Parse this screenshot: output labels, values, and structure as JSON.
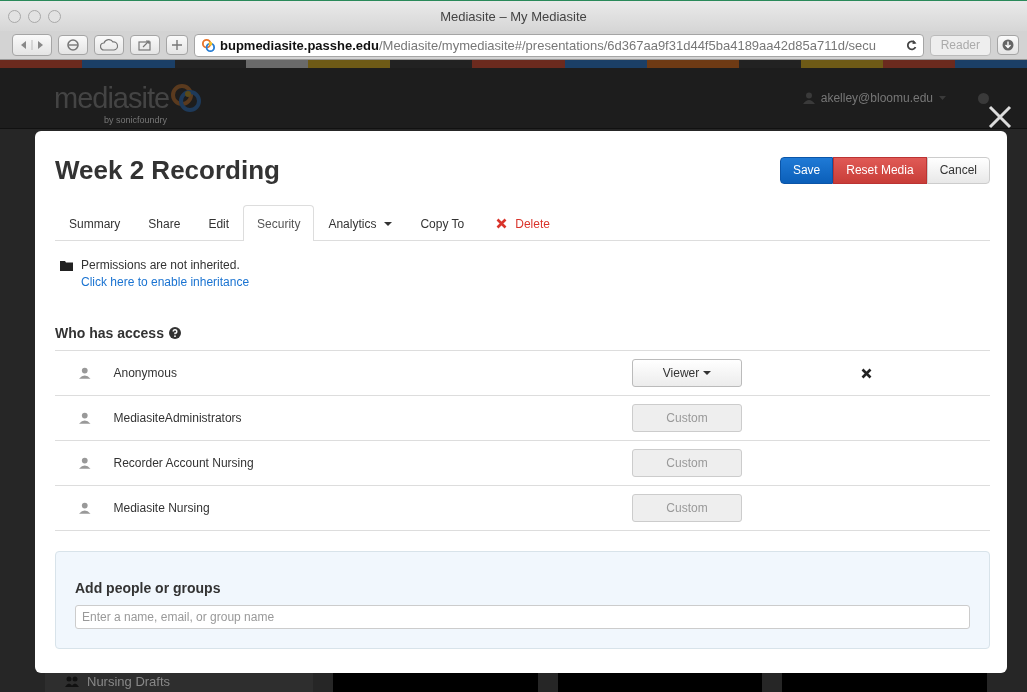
{
  "window": {
    "title": "Mediasite – My Mediasite"
  },
  "toolbar": {
    "url_host": "bupmediasite.passhe.edu",
    "url_path": "/Mediasite/mymediasite#/presentations/6d367aa9f31d44f5ba4189aa42d85a711d/secu",
    "reader": "Reader"
  },
  "header": {
    "logo": "mediasite",
    "logo_sub": "by sonicfoundry",
    "user": "akelley@bloomu.edu"
  },
  "background": {
    "sidebar_item": "Nursing Drafts"
  },
  "dialog": {
    "title": "Week 2 Recording",
    "buttons": [
      {
        "label": "Save",
        "kind": "primary"
      },
      {
        "label": "Reset Media",
        "kind": "danger"
      },
      {
        "label": "Cancel",
        "kind": "default"
      }
    ],
    "tabs": [
      {
        "label": "Summary",
        "selected": false,
        "kind": "plain"
      },
      {
        "label": "Share",
        "selected": false,
        "kind": "plain"
      },
      {
        "label": "Edit",
        "selected": false,
        "kind": "plain"
      },
      {
        "label": "Security",
        "selected": true,
        "kind": "plain"
      },
      {
        "label": "Analytics",
        "selected": false,
        "kind": "dropdown"
      },
      {
        "label": "Copy To",
        "selected": false,
        "kind": "plain"
      },
      {
        "label": "Delete",
        "selected": false,
        "kind": "danger"
      }
    ],
    "notice": "Permissions are not inherited.",
    "notice_link": "Click here to enable inheritance",
    "access_title": "Who has access",
    "access": [
      {
        "name": "Anonymous",
        "role": "Viewer",
        "disabled": false,
        "removable": true
      },
      {
        "name": "MediasiteAdministrators",
        "role": "Custom",
        "disabled": true,
        "removable": false
      },
      {
        "name": "Recorder Account Nursing",
        "role": "Custom",
        "disabled": true,
        "removable": false
      },
      {
        "name": "Mediasite Nursing",
        "role": "Custom",
        "disabled": true,
        "removable": false
      }
    ],
    "add": {
      "title": "Add people or groups",
      "placeholder": "Enter a name, email, or group name"
    }
  }
}
